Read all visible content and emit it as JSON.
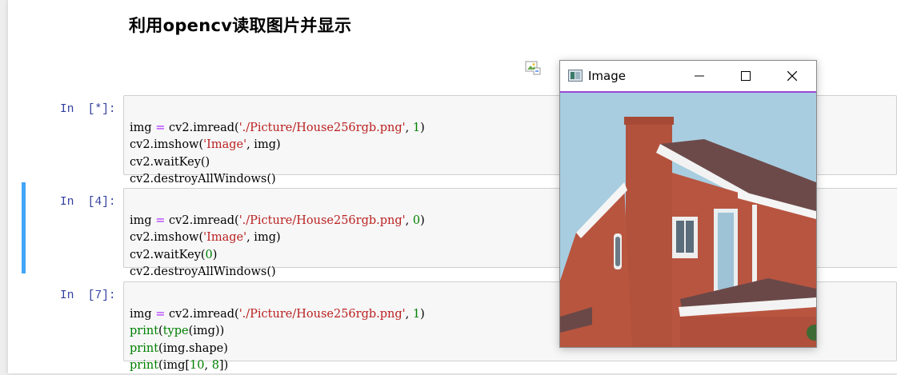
{
  "heading": "利用opencv读取图片并显示",
  "cells": [
    {
      "prompt": "In  [*]:",
      "lines": [
        [
          "img ",
          "=",
          " cv2.imread(",
          "'./Picture/House256rgb.png'",
          ", ",
          "1",
          ")"
        ],
        [
          "cv2.imshow(",
          "'Image'",
          ", img)"
        ],
        [
          "cv2.waitKey()"
        ],
        [
          "cv2.destroyAllWindows()"
        ]
      ]
    },
    {
      "prompt": "In  [4]:",
      "lines": [
        [
          "img ",
          "=",
          " cv2.imread(",
          "'./Picture/House256rgb.png'",
          ", ",
          "0",
          ")"
        ],
        [
          "cv2.imshow(",
          "'Image'",
          ", img)"
        ],
        [
          "cv2.waitKey(",
          "0",
          ")"
        ],
        [
          "cv2.destroyAllWindows()"
        ]
      ]
    },
    {
      "prompt": "In  [7]:",
      "lines": [
        [
          "img ",
          "=",
          " cv2.imread(",
          "'./Picture/House256rgb.png'",
          ", ",
          "1",
          ")"
        ],
        [
          "print",
          "(",
          "type",
          "(img))"
        ],
        [
          "print",
          "(img.shape)"
        ],
        [
          "print",
          "(img[",
          "10",
          ", ",
          "8",
          "])"
        ]
      ]
    }
  ],
  "cv_window": {
    "title": "Image",
    "minimize_icon": "minimize-icon",
    "maximize_icon": "maximize-icon",
    "close_icon": "close-icon"
  },
  "colors": {
    "prompt": "#303f9f",
    "string": "#ba2121",
    "number": "#008000",
    "selected_bar": "#42a5f5",
    "window_accent": "#9b47d9"
  }
}
